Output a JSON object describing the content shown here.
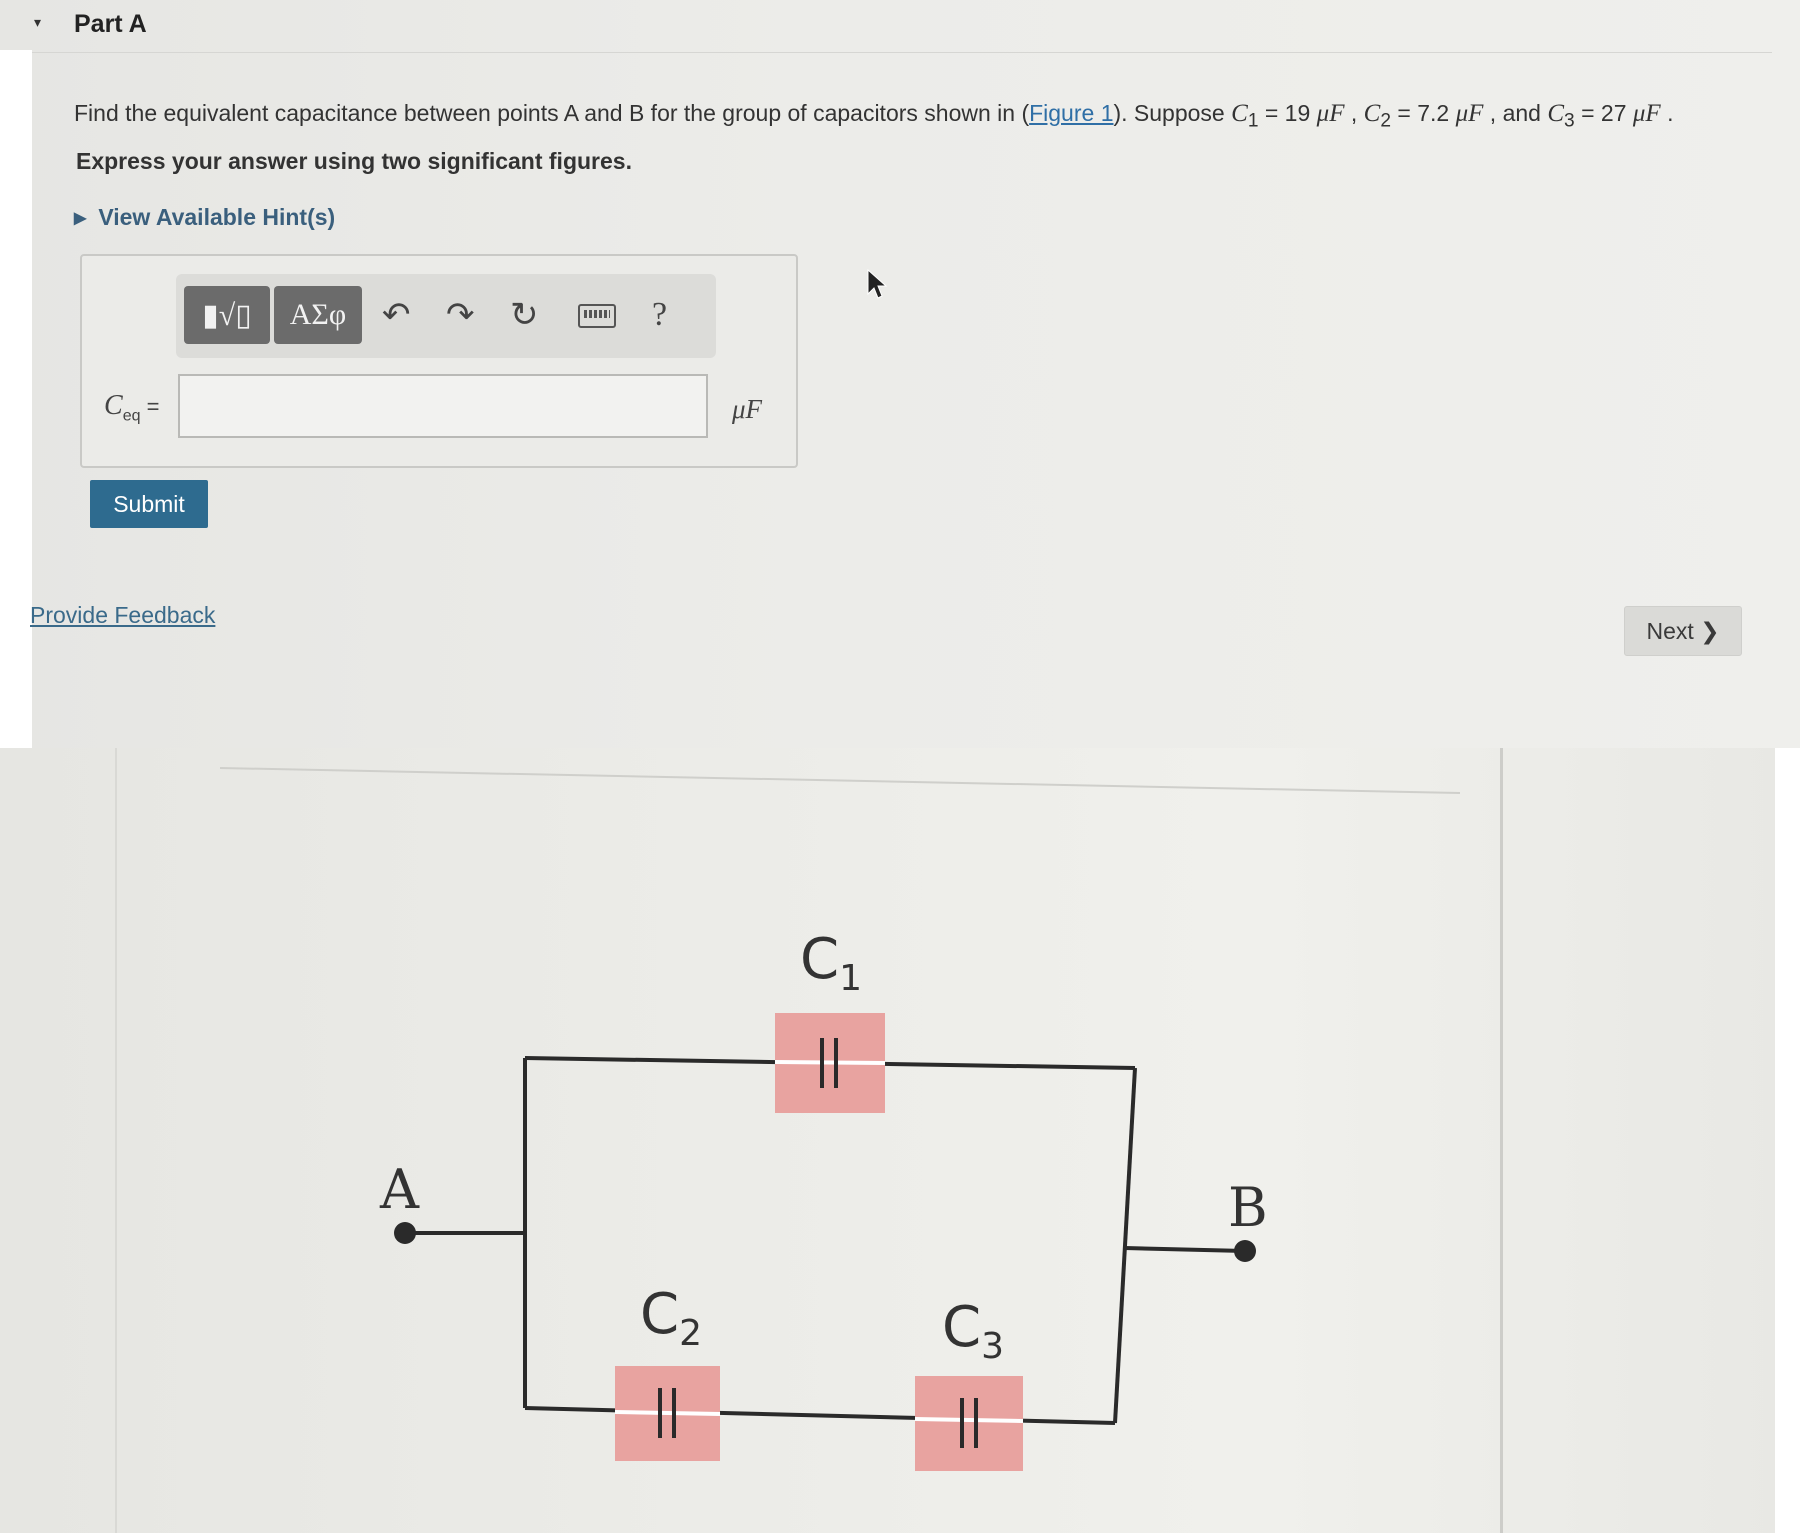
{
  "part": {
    "caret": "▾",
    "title": "Part A"
  },
  "question": {
    "text_before": "Find the equivalent capacitance between points A and B for the group of capacitors shown in (",
    "figure_link": "Figure 1",
    "text_after": "). Suppose ",
    "c1_symbol": "C",
    "c1_sub": "1",
    "c1_value": " = 19 ",
    "c2_symbol": "C",
    "c2_sub": "2",
    "c2_value": " = 7.2 ",
    "c3_symbol": "C",
    "c3_sub": "3",
    "c3_value": " = 27 ",
    "unit": "μF",
    "sep1": " , ",
    "sep2": " , and ",
    "end": " ."
  },
  "instruction": "Express your answer using two significant figures.",
  "hint": {
    "label": "View Available Hint(s)"
  },
  "toolbar": {
    "templates_label": "▮√▯",
    "greek_label": "ΑΣφ",
    "undo_icon": "undo-icon",
    "redo_icon": "redo-icon",
    "reset_icon": "reset-icon",
    "keyboard_icon": "keyboard-icon",
    "help_label": "?"
  },
  "answer": {
    "label_symbol": "C",
    "label_sub": "eq",
    "label_eq": " =",
    "value": "",
    "unit": "μF"
  },
  "buttons": {
    "submit": "Submit",
    "feedback": "Provide Feedback",
    "next": "Next ❯"
  },
  "figure": {
    "point_a": "A",
    "point_b": "B",
    "c1_label": "C",
    "c1_sub": "1",
    "c2_label": "C",
    "c2_sub": "2",
    "c3_label": "C",
    "c3_sub": "3"
  },
  "colors": {
    "capacitor_highlight": "#e8a3a0",
    "link": "#2f6fa6",
    "submit_bg": "#2e6b8f"
  }
}
